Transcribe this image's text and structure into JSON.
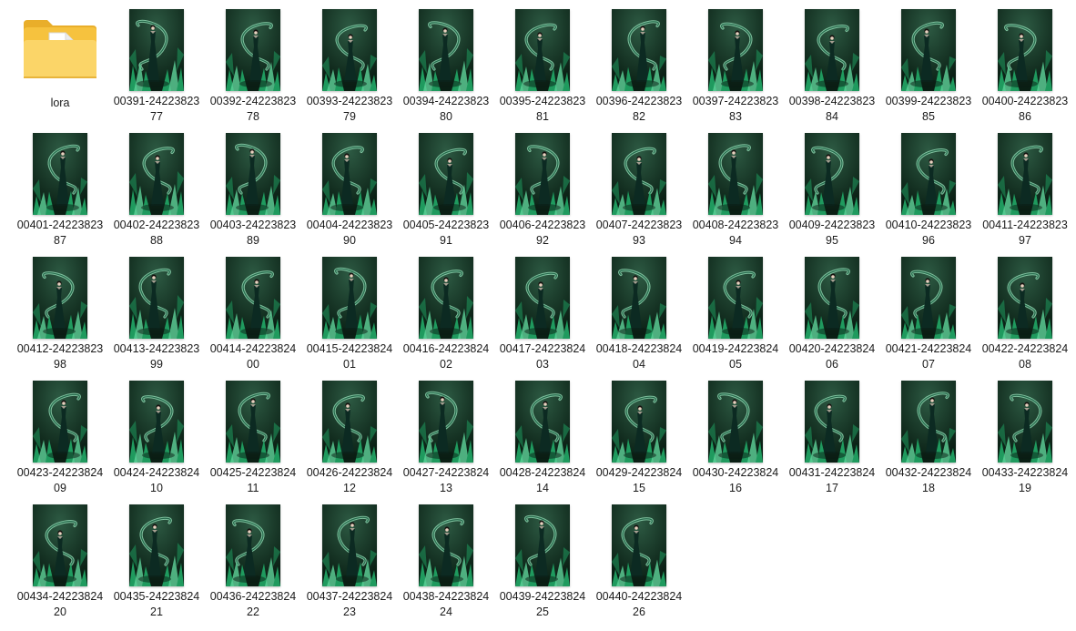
{
  "folder": {
    "name": "lora",
    "icon": "folder-icon",
    "colors": {
      "body": "#f8c94d",
      "front": "#fbd568",
      "tab": "#e9ae2a",
      "paper": "#ffffff"
    }
  },
  "files": [
    "00391-2422382377",
    "00392-2422382378",
    "00393-2422382379",
    "00394-2422382380",
    "00395-2422382381",
    "00396-2422382382",
    "00397-2422382383",
    "00398-2422382384",
    "00399-2422382385",
    "00400-2422382386",
    "00401-2422382387",
    "00402-2422382388",
    "00403-2422382389",
    "00404-2422382390",
    "00405-2422382391",
    "00406-2422382392",
    "00407-2422382393",
    "00408-2422382394",
    "00409-2422382395",
    "00410-2422382396",
    "00411-2422382397",
    "00412-2422382398",
    "00413-2422382399",
    "00414-2422382400",
    "00415-2422382401",
    "00416-2422382402",
    "00417-2422382403",
    "00418-2422382404",
    "00419-2422382405",
    "00420-2422382406",
    "00421-2422382407",
    "00422-2422382408",
    "00423-2422382409",
    "00424-2422382410",
    "00425-2422382411",
    "00426-2422382412",
    "00427-2422382413",
    "00428-2422382414",
    "00429-2422382415",
    "00430-2422382416",
    "00431-2422382417",
    "00432-2422382418",
    "00433-2422382419",
    "00434-2422382420",
    "00435-2422382421",
    "00436-2422382422",
    "00437-2422382423",
    "00438-2422382424",
    "00439-2422382425",
    "00440-2422382426"
  ],
  "thumbnail": {
    "icon": "image-thumbnail",
    "colors": {
      "bg_dark": "#0a1f14",
      "bg_light": "#2d5a43",
      "crystal": "#1f9a5e",
      "crystal_light": "#5fd39a",
      "dragon": "#8fd6b0",
      "dress": "#0c2a22",
      "skin": "#e8d2c0",
      "hair": "#15110f"
    }
  }
}
